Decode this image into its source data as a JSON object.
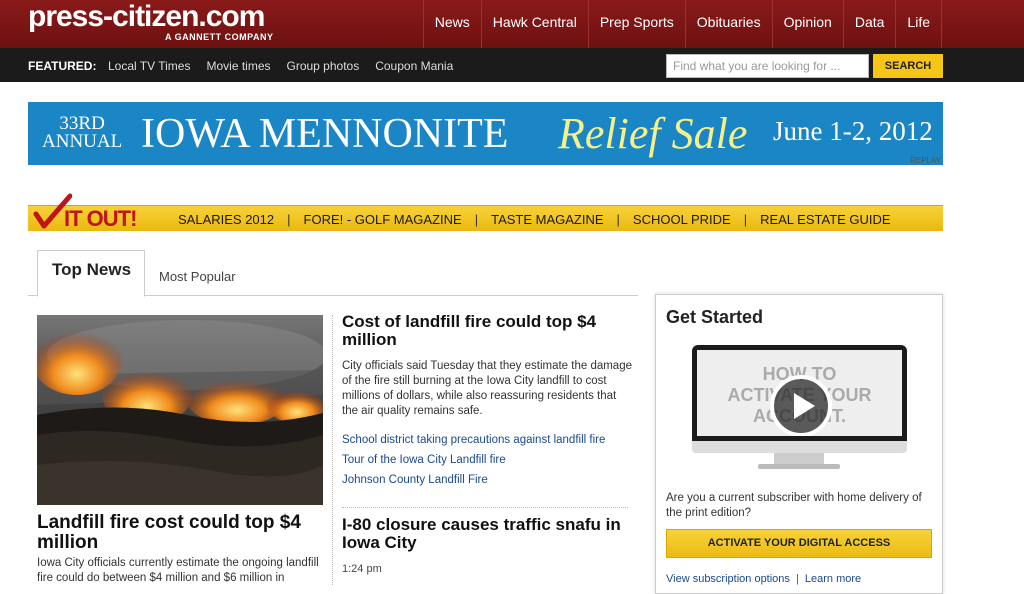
{
  "header": {
    "logo": "press-citizen.com",
    "logo_sub": "A GANNETT COMPANY",
    "nav": [
      "News",
      "Hawk Central",
      "Prep Sports",
      "Obituaries",
      "Opinion",
      "Data",
      "Life"
    ]
  },
  "featured": {
    "label": "FEATURED:",
    "links": [
      "Local TV Times",
      "Movie times",
      "Group photos",
      "Coupon Mania"
    ]
  },
  "search": {
    "placeholder": "Find what you are looking for ...",
    "button": "SEARCH"
  },
  "banner_ad": {
    "annual_line1": "33RD",
    "annual_line2": "ANNUAL",
    "main": "IOWA MENNONITE",
    "relief": "Relief Sale",
    "date": "June 1-2, 2012",
    "replay": "REPLAY"
  },
  "check_it_out": {
    "logo": "IT OUT!",
    "links": [
      "SALARIES 2012",
      "FORE! - GOLF MAGAZINE",
      "TASTE MAGAZINE",
      "SCHOOL PRIDE",
      "REAL ESTATE GUIDE"
    ]
  },
  "tabs": {
    "active": "Top News",
    "inactive": "Most Popular"
  },
  "lead_story": {
    "title": "Landfill fire cost could top $4 million",
    "summary": "Iowa City officials currently estimate the ongoing landfill fire could do between $4 million and $6 million in"
  },
  "story2": {
    "title": "Cost of landfill fire could top $4 million",
    "summary": "City officials said Tuesday that they estimate the damage of the fire still burning at the Iowa City landfill to cost millions of dollars, while also reassuring residents that the air quality remains safe.",
    "related": [
      "School district taking precautions against landfill fire",
      "Tour of the Iowa City Landfill fire",
      "Johnson County Landfill Fire"
    ]
  },
  "story3": {
    "title": "I-80 closure causes traffic snafu in Iowa City",
    "time": "1:24 pm"
  },
  "get_started": {
    "title": "Get Started",
    "screen_text": "HOW TO\nACTIVATE YOUR\nACCOUNT.",
    "text": "Are you a current subscriber with home delivery of the print edition?",
    "button": "ACTIVATE YOUR DIGITAL ACCESS",
    "link1": "View subscription options",
    "separator": "|",
    "link2": "Learn more"
  }
}
